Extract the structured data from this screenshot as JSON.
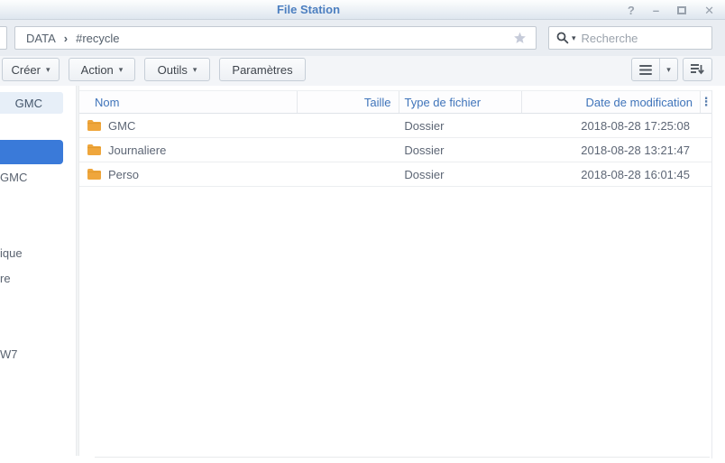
{
  "window": {
    "title": "File Station"
  },
  "icons": {
    "help": "?",
    "minimize": "–",
    "close": "✕",
    "crumb_separator": "›",
    "caret_down": "▾",
    "dots_menu": "⋮"
  },
  "pathbar": {
    "crumbs": [
      "DATA",
      "#recycle"
    ],
    "search_placeholder": "Recherche"
  },
  "toolbar": {
    "create_label": "Créer",
    "action_label": "Action",
    "tools_label": "Outils",
    "settings_label": "Paramètres"
  },
  "sidebar": {
    "items": [
      {
        "label": "GMC",
        "state": "highlighted"
      },
      {
        "label": "",
        "state": "selected"
      },
      {
        "label": "GMC",
        "state": "normal"
      },
      {
        "label": "ique",
        "state": "normal"
      },
      {
        "label": "re",
        "state": "normal"
      },
      {
        "label": "W7",
        "state": "normal"
      }
    ]
  },
  "filetable": {
    "columns": [
      "Nom",
      "Taille",
      "Type de fichier",
      "Date de modification"
    ],
    "rows": [
      {
        "name": "GMC",
        "size": "",
        "type": "Dossier",
        "modified": "2018-08-28 17:25:08"
      },
      {
        "name": "Journaliere",
        "size": "",
        "type": "Dossier",
        "modified": "2018-08-28 13:21:47"
      },
      {
        "name": "Perso",
        "size": "",
        "type": "Dossier",
        "modified": "2018-08-28 16:01:45"
      }
    ]
  },
  "colors": {
    "accent_blue": "#3a7ad9",
    "header_text": "#3f74ba",
    "title_text": "#4c7fc0",
    "folder": "#efa63c"
  }
}
